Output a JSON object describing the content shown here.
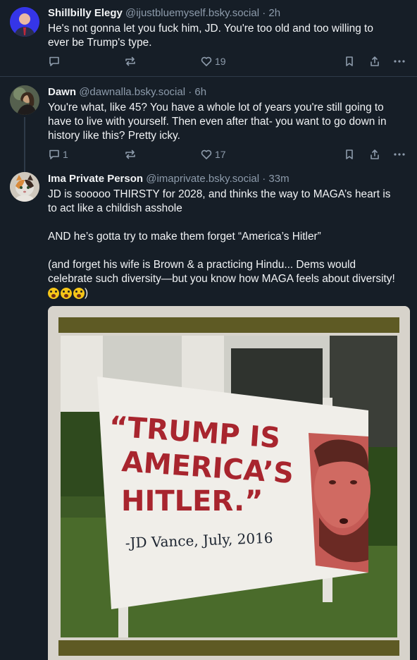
{
  "posts": [
    {
      "name": "Shillbilly Elegy",
      "handle": "@ijustbluemyself.bsky.social",
      "time": "· 2h",
      "lines": [
        "He's not gonna let you fuck him, JD. You're too old and too willing to",
        "ever be Trump's type."
      ],
      "replies": "",
      "likes": "19"
    },
    {
      "name": "Dawn",
      "handle": "@dawnalla.bsky.social",
      "time": "· 6h",
      "lines": [
        "You're what, like 45?  You have a whole lot of years you're still going to",
        "have to live with yourself.  Then even after that- you want to go down in",
        "history like this?  Pretty icky."
      ],
      "replies": "1",
      "likes": "17"
    },
    {
      "name": "Ima Private Person",
      "handle": "@imaprivate.bsky.social",
      "time": "· 33m",
      "lines": [
        "JD is sooooo THIRSTY for 2028, and thinks the way to MAGA’s heart is",
        "to act like a childish asshole",
        "",
        "AND he’s gotta try to make them forget “America’s Hitler”",
        "",
        "(and forget his wife is Brown & a practicing Hindu... Dems would",
        "celebrate such diversity—but you know how MAGA feels about diversity!"
      ],
      "emoji_tail": ")",
      "image": {
        "sign_quote_line1": "“TRUMP IS",
        "sign_quote_line2": "AMERICA’S",
        "sign_quote_line3": "HITLER.”",
        "sign_attribution": "-JD Vance, July, 2016"
      }
    }
  ],
  "colors": {
    "background": "#161e27",
    "muted": "#8d9bab",
    "divider": "#2e3b49",
    "sign_red": "#a8252e"
  }
}
